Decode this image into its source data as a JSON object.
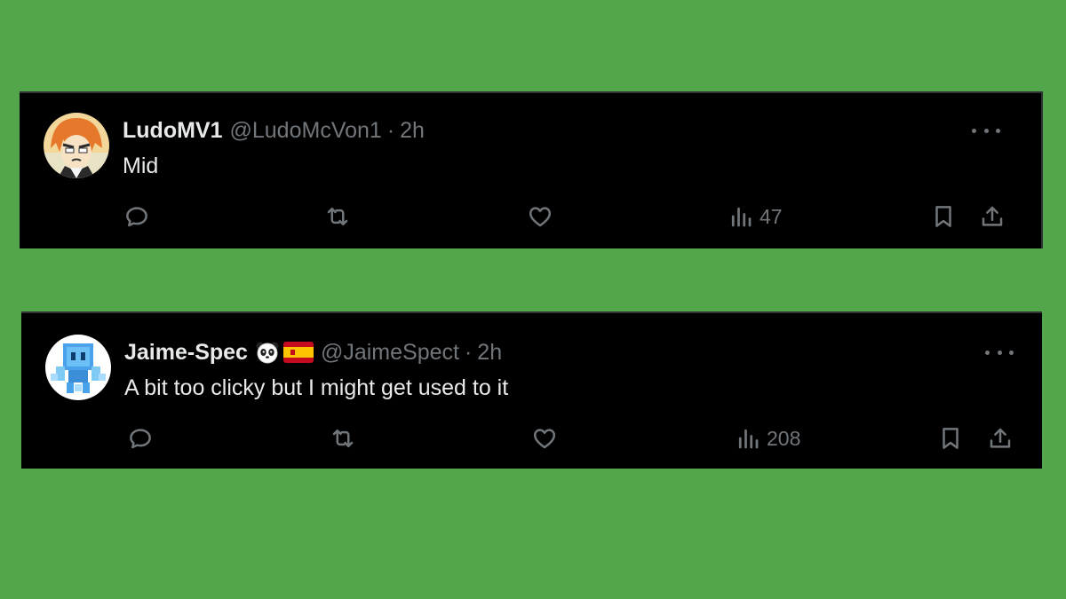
{
  "tweets": [
    {
      "name": "LudoMV1",
      "handle": "@LudoMcVon1",
      "separator": "·",
      "time": "2h",
      "text": "Mid",
      "views": "47",
      "avatar_icon": "anime-avatar"
    },
    {
      "name": "Jaime-Spec",
      "badges": [
        "panda-emoji",
        "spain-flag-emoji"
      ],
      "handle": "@JaimeSpect",
      "separator": "·",
      "time": "2h",
      "text": "A bit too clicky but I might get used to it",
      "views": "208",
      "avatar_icon": "pixel-robot-avatar"
    }
  ],
  "colors": {
    "background": "#54a64c",
    "card": "#000000",
    "primary_text": "#e7e9ea",
    "secondary_text": "#71767b"
  }
}
